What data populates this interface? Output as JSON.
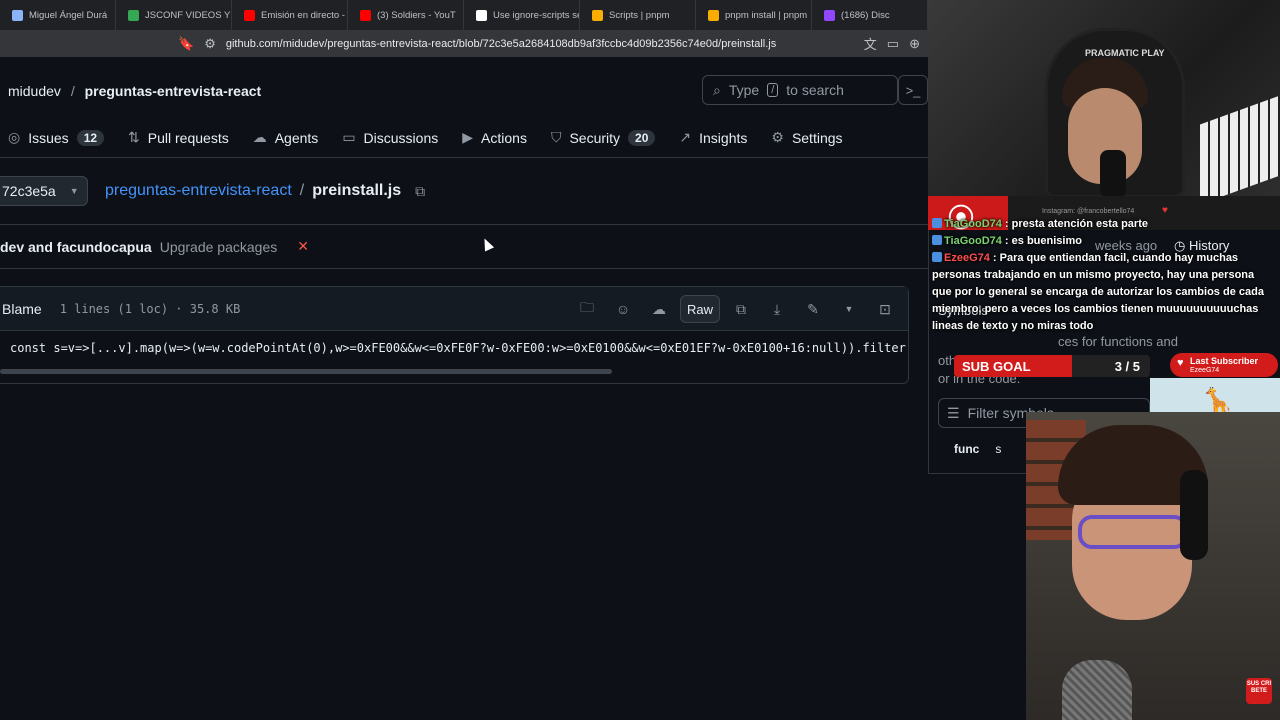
{
  "browser": {
    "tabs": [
      {
        "label": "Miguel Ángel Durá",
        "color": "#8ab4f8"
      },
      {
        "label": "JSCONF VIDEOS Y TA",
        "color": "#34a853"
      },
      {
        "label": "Emisión en directo - Y",
        "color": "#ff0000"
      },
      {
        "label": "(3) Soldiers - YouT",
        "color": "#ff0000"
      },
      {
        "label": "Use ignore-scripts se",
        "color": "#ffffff"
      },
      {
        "label": "Scripts | pnpm",
        "color": "#f9ad00"
      },
      {
        "label": "pnpm install | pnpm",
        "color": "#f9ad00"
      },
      {
        "label": "(1686) Disc",
        "color": "#9146ff"
      }
    ],
    "url": "github.com/midudev/preguntas-entrevista-react/blob/72c3e5a2684108db9af3fccbc4d09b2356c74e0d/preinstall.js"
  },
  "header": {
    "owner": "midudev",
    "separator": "/",
    "repo": "preguntas-entrevista-react",
    "search_prefix": "Type",
    "search_key": "/",
    "search_suffix": "to search"
  },
  "nav": [
    {
      "label": "Issues",
      "count": "12",
      "icon": "◎"
    },
    {
      "label": "Pull requests",
      "count": "",
      "icon": "⇅"
    },
    {
      "label": "Agents",
      "count": "",
      "icon": "☁"
    },
    {
      "label": "Discussions",
      "count": "",
      "icon": "▭"
    },
    {
      "label": "Actions",
      "count": "",
      "icon": "▶"
    },
    {
      "label": "Security",
      "count": "20",
      "icon": "⛉"
    },
    {
      "label": "Insights",
      "count": "",
      "icon": "↗"
    },
    {
      "label": "Settings",
      "count": "",
      "icon": "⚙"
    }
  ],
  "file": {
    "branch": "72c3e5a",
    "repo_link": "preguntas-entrevista-react",
    "crumb_sep": "/",
    "filename": "preinstall.js",
    "commit_authors": "dev and facundocapua",
    "commit_msg": "Upgrade packages",
    "blame_label": "Blame",
    "meta": "1 lines (1 loc) · 35.8 KB",
    "raw_label": "Raw",
    "code": "const s=v=>[...v].map(w=>(w=w.codePointAt(0),w>=0xFE00&&w<=0xFE0F?w-0xFE00:w>=0xE0100&&w<=0xE01EF?w-0xE0100+16:null)).filter",
    "scroll_position": 0.67
  },
  "side_panel": {
    "history_label": "History",
    "history_time": "weeks ago",
    "symbols_label": "Symbols",
    "symbols_desc_1": "ces for functions and",
    "symbols_desc_2": "oth",
    "symbols_desc_3": "or in the code.",
    "filter_placeholder": "Filter symbols",
    "func_label": "func",
    "func_name": "s"
  },
  "stream": {
    "chair_brand": "PRAGMATIC PLAY",
    "instagram": "Instagram: @francobertello74",
    "chat": [
      {
        "user": "TiaGooD74",
        "text": " : presta atención esta parte"
      },
      {
        "user": "TiaGooD74",
        "text": " : es buenisimo"
      },
      {
        "user": "EzeeG74",
        "text": " : Para que entiendan facil, cuando hay muchas personas trabajando en un mismo proyecto, hay una persona que por lo general se encarga de autorizar los cambios de cada miembro, pero a veces los cambios tienen muuuuuuuuuuchas lineas de texto y no miras todo"
      }
    ],
    "sub_goal_label": "SUB GOAL",
    "sub_goal_count": "3 / 5",
    "sub_goal_progress": 0.6,
    "last_sub_label": "Last Subscriber",
    "last_sub_name": "EzeeG74",
    "subscribe_text": "SUS CRI BETE",
    "accent": "#d21c1c"
  }
}
